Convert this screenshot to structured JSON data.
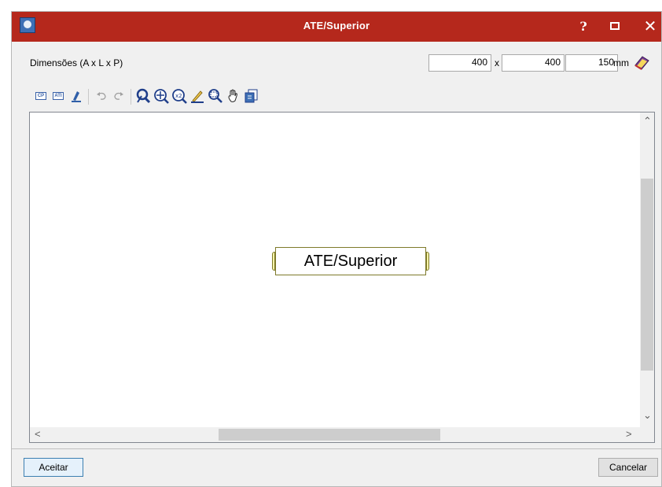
{
  "window": {
    "title": "ATE/Superior",
    "help_glyph": "?",
    "close_glyph": "✕"
  },
  "dimensions": {
    "label": "Dimensões (A x L x P)",
    "height": "400",
    "width": "400",
    "depth": "150",
    "separator": "x",
    "unit": "mm"
  },
  "toolbar": {
    "icons": [
      "cp-tag-icon",
      "ati-tag-icon",
      "pen-icon",
      "undo-icon",
      "redo-icon",
      "select-icon",
      "zoom-extents-icon",
      "zoom-x2-icon",
      "edit-icon",
      "zoom-window-icon",
      "pan-hand-icon",
      "export-icon"
    ],
    "cp_text": "CP",
    "ati_text": "ATI"
  },
  "canvas": {
    "element_label": "ATE/Superior"
  },
  "buttons": {
    "accept": "Aceitar",
    "cancel": "Cancelar"
  },
  "colors": {
    "titlebar": "#b5281c",
    "accent": "#3c7fb1"
  }
}
